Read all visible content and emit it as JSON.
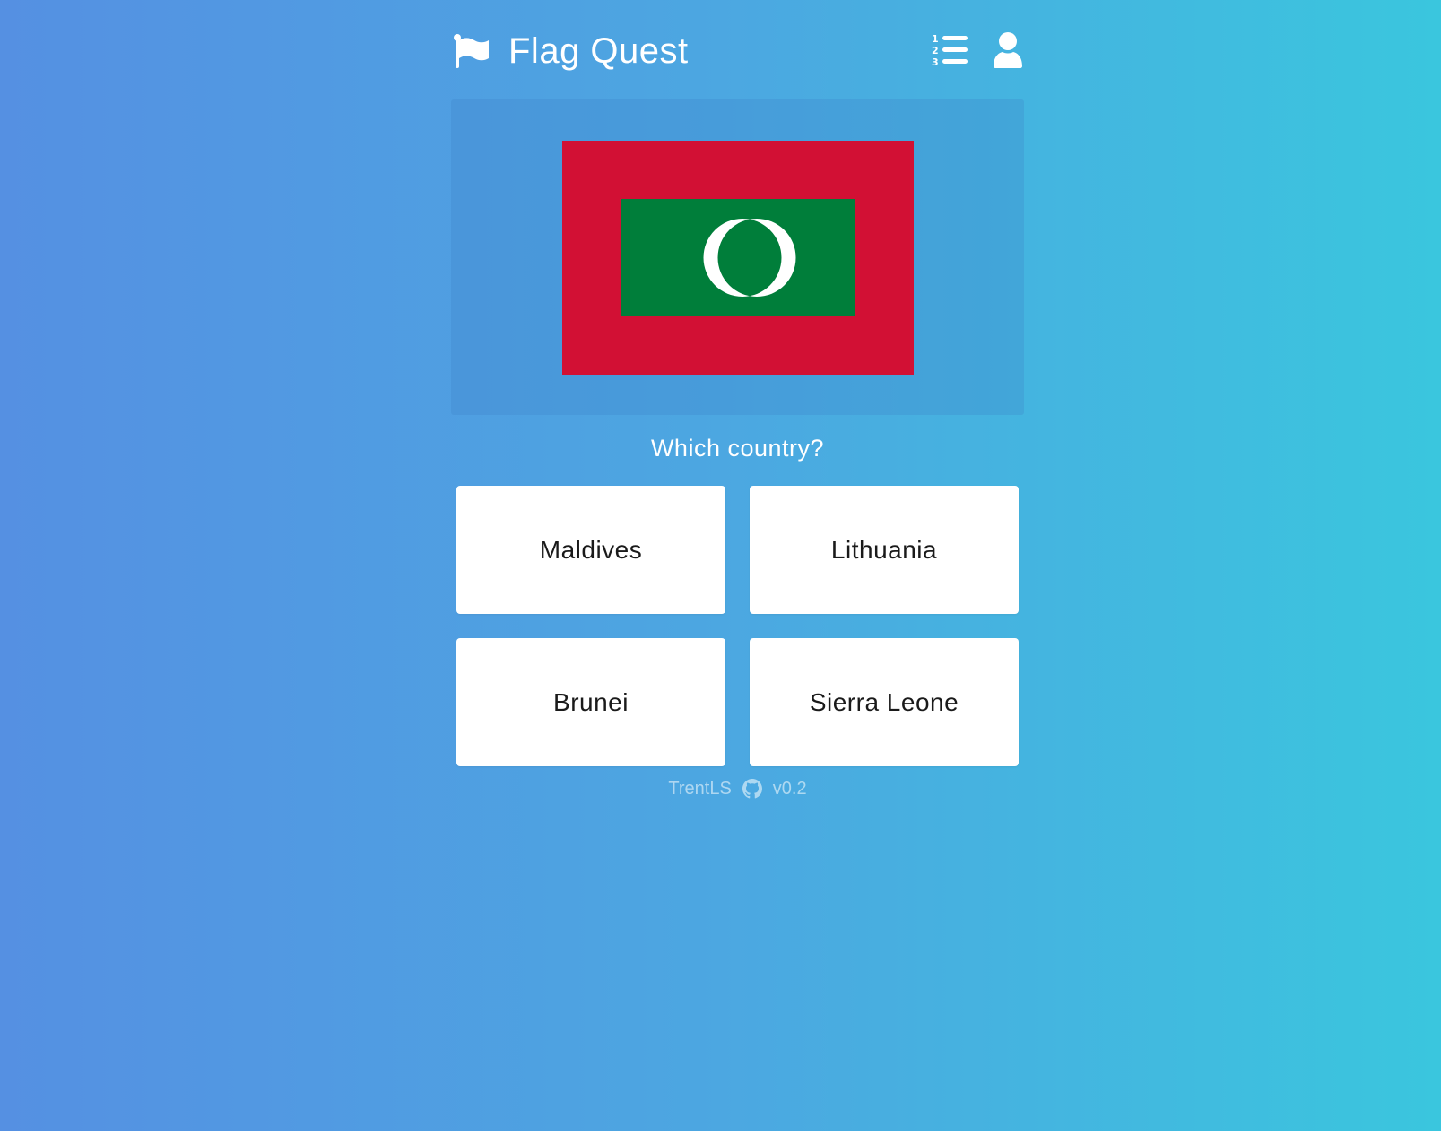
{
  "app": {
    "title": "Flag Quest"
  },
  "header": {
    "icons": [
      "flag-icon",
      "leaderboard-icon",
      "user-icon"
    ]
  },
  "flag": {
    "country_shown": "Maldives flag",
    "colors": {
      "red": "#d21034",
      "green": "#007e3a",
      "crescent": "#ffffff"
    }
  },
  "question": {
    "text": "Which country?"
  },
  "answers": [
    {
      "label": "Maldives"
    },
    {
      "label": "Lithuania"
    },
    {
      "label": "Brunei"
    },
    {
      "label": "Sierra Leone"
    }
  ],
  "footer": {
    "author": "TrentLS",
    "icon": "github-icon",
    "version": "v0.2"
  },
  "theme": {
    "gradient_start": "#5590e2",
    "gradient_end": "#3ac6de",
    "card_bg": "#ffffff",
    "text_light": "#ffffff",
    "text_dark": "#1a1a1a"
  }
}
